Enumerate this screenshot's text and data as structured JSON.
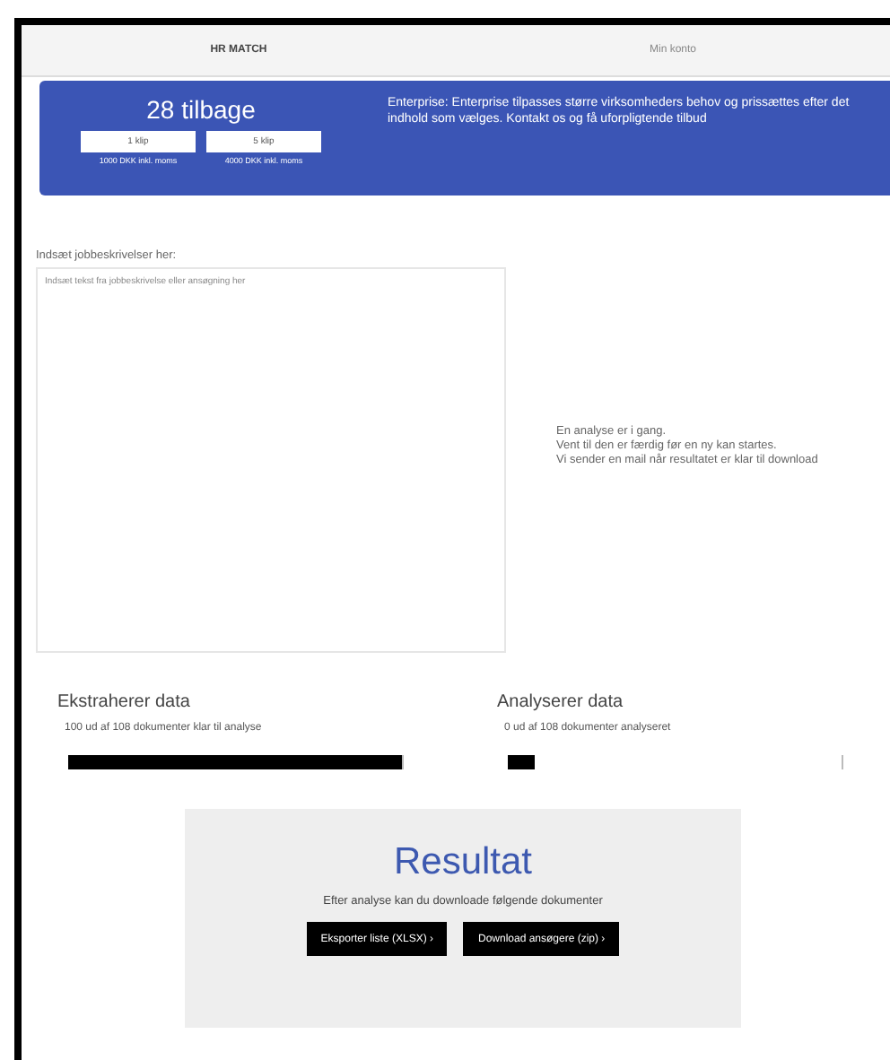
{
  "nav": {
    "items": [
      {
        "label": "HR MATCH",
        "selected": true
      },
      {
        "label": "Min konto",
        "selected": false
      }
    ]
  },
  "banner": {
    "title": "28 tilbage",
    "options": [
      {
        "button": "1 klip",
        "price": "1000 DKK inkl. moms"
      },
      {
        "button": "5 klip",
        "price": "4000 DKK inkl. moms"
      }
    ],
    "description": "Enterprise: Enterprise tilpasses større virksomheders behov og prissættes efter det indhold som vælges. Kontakt os og få uforpligtende tilbud"
  },
  "input": {
    "label": "Indsæt jobbeskrivelser her:",
    "placeholder": "Indsæt tekst fra jobbeskrivelse eller ansøgning her"
  },
  "status": [
    "En analyse er i gang.",
    "Vent til den er færdig før en ny kan startes.",
    "Vi sender en mail når resultatet er klar til download"
  ],
  "progress": [
    {
      "title": "Ekstraherer data",
      "caption": "100 ud af 108 dokumenter klar til analyse",
      "level": 1
    },
    {
      "title": "Analyserer data",
      "caption": "0 ud af 108 dokumenter analyseret",
      "level": 0.08
    }
  ],
  "result": {
    "title": "Resultat",
    "text": "Efter analyse kan du downloade følgende dokumenter",
    "buttons": [
      "Eksporter liste (XLSX) ›",
      "Download ansøgere (zip) ›"
    ]
  }
}
